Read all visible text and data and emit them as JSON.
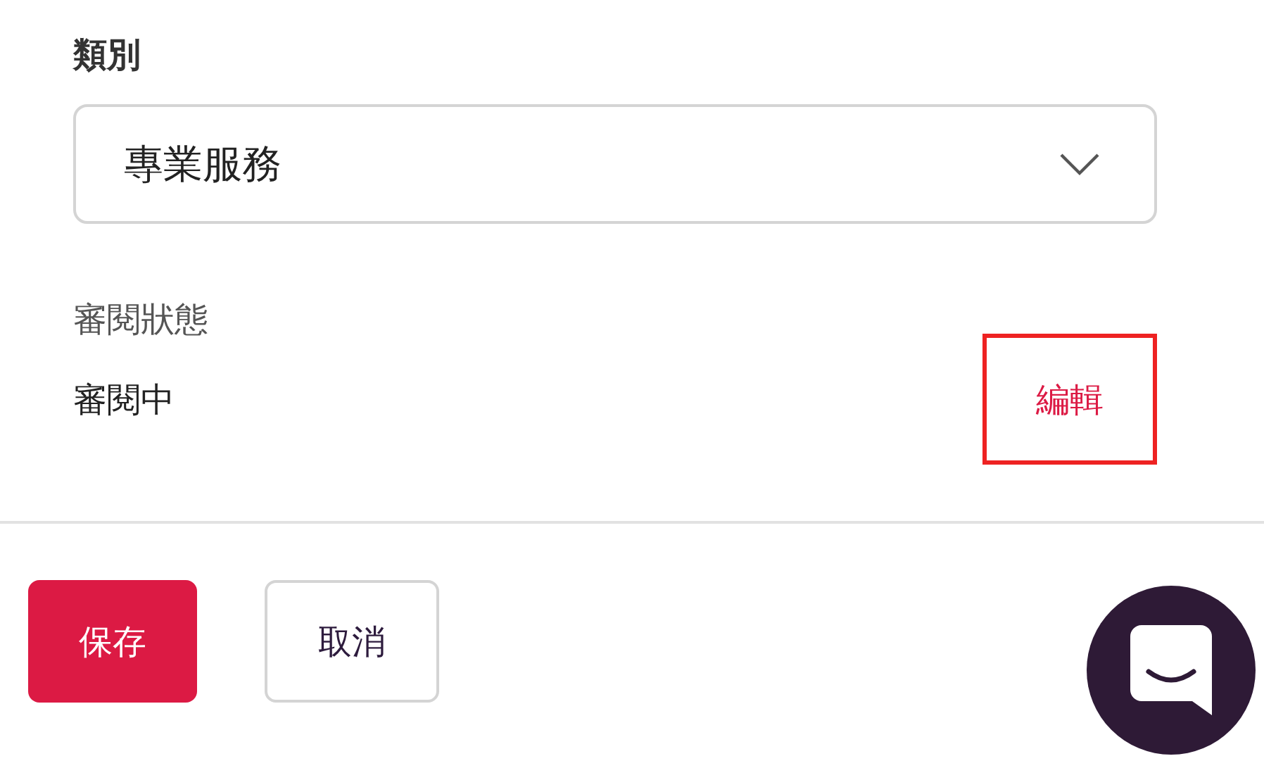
{
  "category": {
    "label": "類別",
    "value": "專業服務"
  },
  "review": {
    "label": "審閱狀態",
    "value": "審閱中",
    "edit": {
      "label": "編輯",
      "highlighted": true
    }
  },
  "buttons": [
    {
      "label": "保存",
      "kind": "primary"
    },
    {
      "label": "取消",
      "kind": "secondary"
    }
  ],
  "chat": {
    "kind": "chat"
  }
}
